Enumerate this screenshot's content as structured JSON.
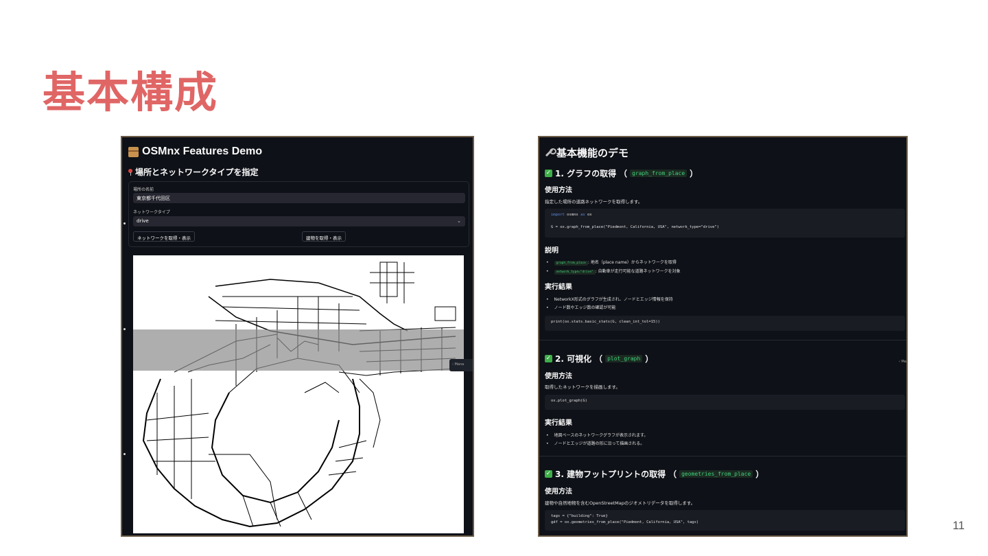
{
  "slide": {
    "title": "基本構成",
    "page_number": "11"
  },
  "left_app": {
    "title": "OSMnx Features Demo",
    "subtitle": "場所とネットワークタイプを指定",
    "place_label": "場所の名前",
    "place_value": "東京都千代田区",
    "network_label": "ネットワークタイプ",
    "network_value": "drive",
    "fetch_network_button": "ネットワークを取得・表示",
    "fetch_buildings_button": "建物を取得・表示",
    "sidebar_toggle": "Mana"
  },
  "right_app": {
    "title": "基本機能のデモ",
    "section1": {
      "number": "1. グラフの取得",
      "func": "graph_from_place",
      "usage_heading": "使用方法",
      "usage_text": "指定した場所の道路ネットワークを取得します。",
      "code_line1": "import osmnx as ox",
      "code_line2": "G = ox.graph_from_place(\"Piedmont, California, USA\", network_type=\"drive\")",
      "explain_heading": "説明",
      "bullet1_code": "graph_from_place",
      "bullet1_text": ": 地名（place name）からネットワークを取得",
      "bullet2_code": "network_type=\"drive\"",
      "bullet2_text": ": 自動車が走行可能な道路ネットワークを対象",
      "result_heading": "実行結果",
      "result1": "NetworkX形式のグラフが生成され、ノードとエッジ情報を保持",
      "result2": "ノード数やエッジ数の確認が可能",
      "code_line3": "print(ox.stats.basic_stats(G, clean_int_tol=15))"
    },
    "section2": {
      "number": "2. 可視化",
      "func": "plot_graph",
      "usage_heading": "使用方法",
      "usage_text": "取得したネットワークを描画します。",
      "code_line": "ox.plot_graph(G)",
      "result_heading": "実行結果",
      "result1": "地図ベースのネットワークグラフが表示されます。",
      "result2": "ノードとエッジが道路の形に沿って描画される。"
    },
    "section3": {
      "number": "3. 建物フットプリントの取得",
      "func": "geometries_from_place",
      "usage_heading": "使用方法",
      "usage_text": "建物や自然地物を含むOpenStreetMapのジオメトリデータを取得します。",
      "code_line1": "tags = {\"building\": True}",
      "code_line2": "gdf = ox.geometries_from_place(\"Piedmont, California, USA\", tags)"
    },
    "sidebar_toggle": "Ma"
  }
}
